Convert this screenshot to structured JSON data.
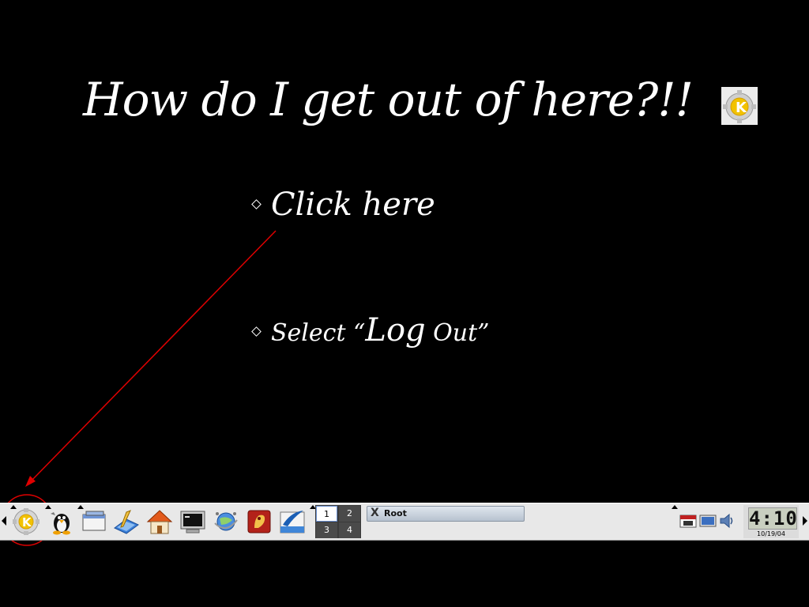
{
  "slide": {
    "title": "How do I get out of here?!!",
    "bullet1": "Click here",
    "bullet2_prefix": "Select “",
    "bullet2_big": "Log",
    "bullet2_suffix": " Out”"
  },
  "colors": {
    "background": "#000000",
    "text": "#ffffff",
    "annotation": "#e00000",
    "taskbar": "#e8e8e8"
  },
  "taskbar": {
    "icons": [
      "kde-menu-icon",
      "tux-icon",
      "window-list-icon",
      "editor-icon",
      "home-icon",
      "terminal-icon",
      "browser-icon",
      "help-icon",
      "office-icon"
    ],
    "pager": [
      "1",
      "2",
      "3",
      "4"
    ],
    "active_desktop": "1",
    "task_label": "Root",
    "tray_icons": [
      "calendar-icon",
      "display-icon",
      "volume-icon"
    ],
    "clock_time": "4:10",
    "clock_date": "10/19/04"
  }
}
